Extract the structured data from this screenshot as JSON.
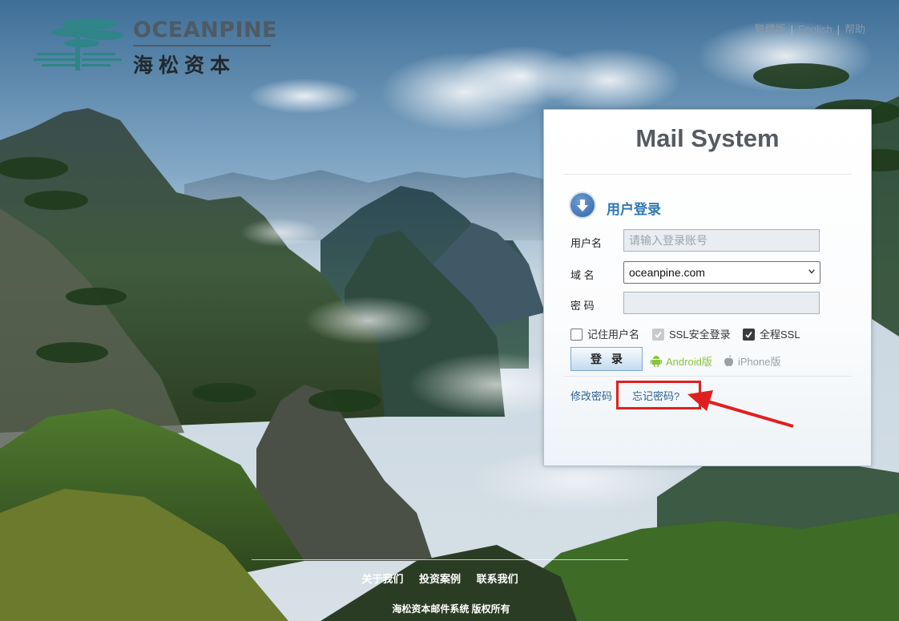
{
  "brand": {
    "name_en": "OCEANPINE",
    "name_cn": "海松资本"
  },
  "top_links": [
    {
      "label": "繁體版"
    },
    {
      "label": "English"
    },
    {
      "label": "帮助"
    }
  ],
  "panel": {
    "title": "Mail System",
    "login_heading": "用户登录",
    "username_label": "用户名",
    "username_value": "",
    "username_placeholder": "请输入登录账号",
    "domain_label": "域 名",
    "domain_selected": "oceanpine.com",
    "password_label": "密 码",
    "password_value": "",
    "checkboxes": [
      {
        "label": "记住用户名",
        "checked": false,
        "disabled": false
      },
      {
        "label": "SSL安全登录",
        "checked": true,
        "disabled": true
      },
      {
        "label": "全程SSL",
        "checked": true,
        "disabled": false
      }
    ],
    "login_button": "登录",
    "android_link": "Android版",
    "iphone_link": "iPhone版",
    "change_password": "修改密码",
    "forgot_password": "忘记密码?"
  },
  "footer": {
    "links": [
      {
        "label": "关于我们"
      },
      {
        "label": "投资案例"
      },
      {
        "label": "联系我们"
      }
    ],
    "copyright": "海松资本邮件系统 版权所有"
  },
  "colors": {
    "panel_title": "#555b60",
    "heading": "#2d78b4",
    "link": "#2a5f94",
    "android": "#8ac43f",
    "iphone": "#9aa0a6",
    "highlight": "#e02020"
  }
}
